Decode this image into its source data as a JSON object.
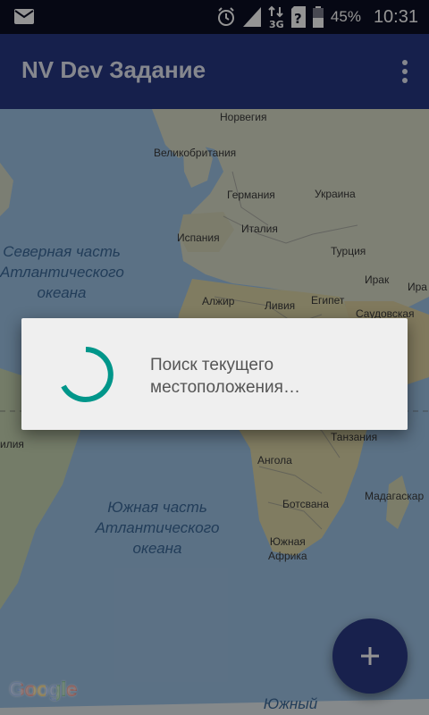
{
  "status_bar": {
    "time": "10:31",
    "battery_percent": "45%",
    "icons": [
      "mail-icon",
      "alarm-icon",
      "signal-icon",
      "network-3g-icon",
      "sim-unknown-icon",
      "battery-icon"
    ]
  },
  "app_bar": {
    "title": "NV Dev Задание",
    "overflow_icon": "more-vert-icon"
  },
  "map": {
    "labels": [
      {
        "key": "norway",
        "text": "Норвегия"
      },
      {
        "key": "uk",
        "text": "Великобритания"
      },
      {
        "key": "germany",
        "text": "Германия"
      },
      {
        "key": "ukraine",
        "text": "Украина"
      },
      {
        "key": "spain",
        "text": "Испания"
      },
      {
        "key": "italy",
        "text": "Италия"
      },
      {
        "key": "turkey",
        "text": "Турция"
      },
      {
        "key": "algeria",
        "text": "Алжир"
      },
      {
        "key": "libya",
        "text": "Ливия"
      },
      {
        "key": "egypt",
        "text": "Египет"
      },
      {
        "key": "iraq",
        "text": "Ирак"
      },
      {
        "key": "iran",
        "text": "Ира"
      },
      {
        "key": "saudi",
        "text": "Саудовская"
      },
      {
        "key": "brazil",
        "text": "илия"
      },
      {
        "key": "tanzania",
        "text": "Танзания"
      },
      {
        "key": "angola",
        "text": "Ангола"
      },
      {
        "key": "madagascar",
        "text": "Мадагаскар"
      },
      {
        "key": "botswana",
        "text": "Ботсвана"
      },
      {
        "key": "south_africa",
        "text": "Южная\nАфрика"
      }
    ],
    "ocean_labels": {
      "north_atlantic": "Северная часть\nАтлантического\nокеана",
      "south_atlantic": "Южная часть\nАтлантического\nокеана",
      "southern": "Южный"
    },
    "attribution": "Google"
  },
  "dialog": {
    "message": "Поиск текущего местоположения…",
    "spinner_color": "#00968a"
  },
  "fab": {
    "icon": "plus-icon",
    "color": "#2a3a86"
  }
}
